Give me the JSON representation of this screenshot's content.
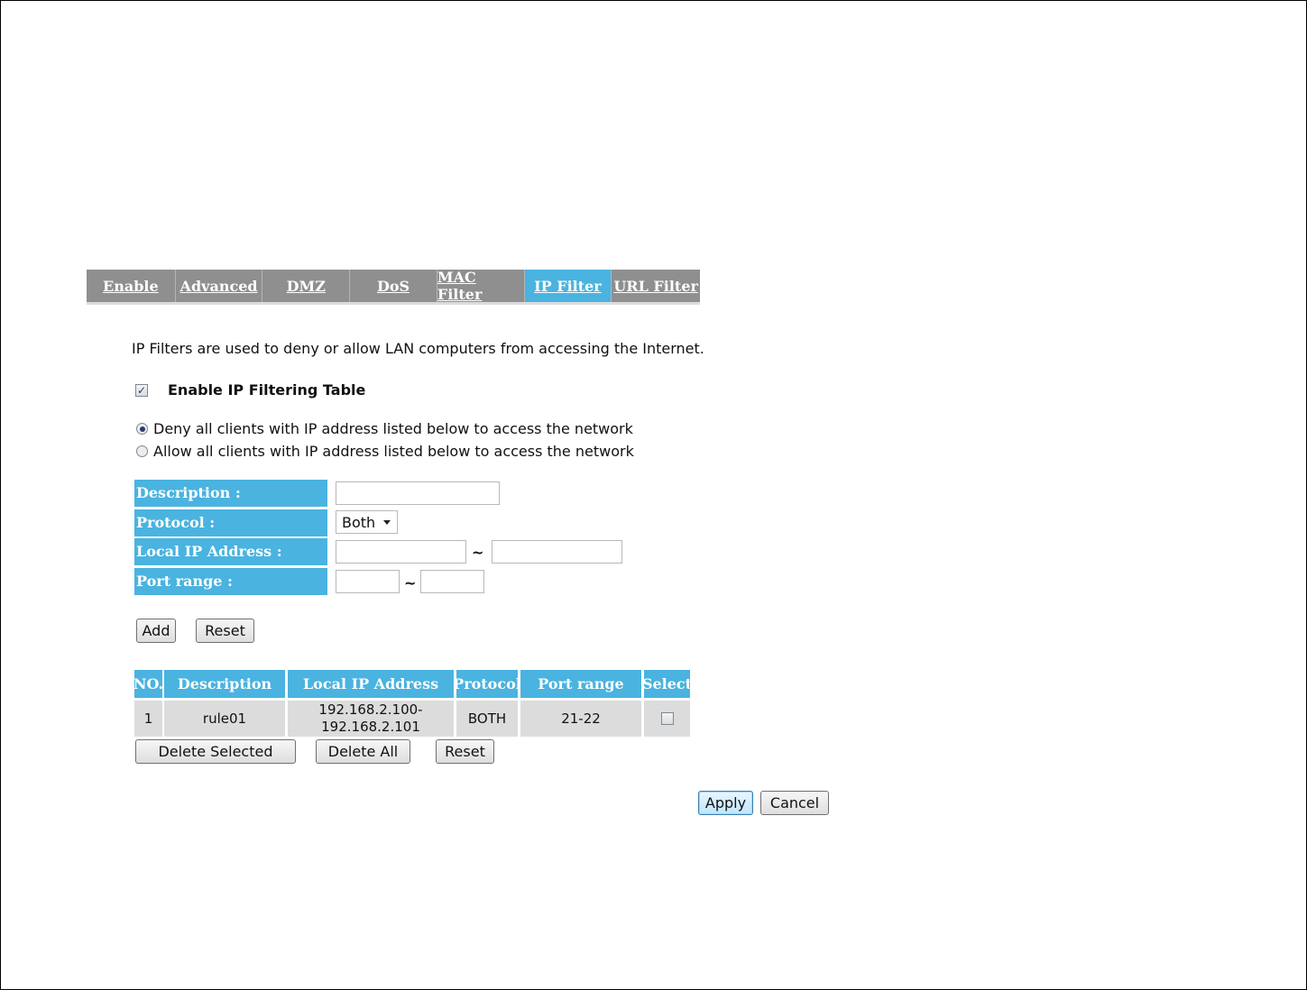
{
  "tabs": [
    "Enable",
    "Advanced",
    "DMZ",
    "DoS",
    "MAC Filter",
    "IP Filter",
    "URL Filter"
  ],
  "active_tab": "IP Filter",
  "intro_text": "IP Filters are used to deny or allow LAN computers from accessing the Internet.",
  "enable_label": "Enable IP Filtering Table",
  "enable_checked": true,
  "radio_deny": "Deny all clients with IP address listed below to access the network",
  "radio_allow": "Allow all clients with IP address listed below to access the network",
  "form": {
    "description_label": "Description :",
    "protocol_label": "Protocol :",
    "protocol_value": "Both",
    "local_ip_label": "Local IP Address :",
    "port_range_label": "Port range :",
    "tilde": "~"
  },
  "form_buttons": {
    "add": "Add",
    "reset": "Reset"
  },
  "table": {
    "headers": [
      "NO.",
      "Description",
      "Local IP Address",
      "Protocol",
      "Port range",
      "Select"
    ],
    "rows": [
      {
        "no": "1",
        "description": "rule01",
        "ip_start": "192.168.2.100-",
        "ip_end": "192.168.2.101",
        "protocol": "BOTH",
        "port_range": "21-22"
      }
    ]
  },
  "table_buttons": {
    "delete_selected": "Delete Selected",
    "delete_all": "Delete All",
    "reset": "Reset"
  },
  "footer_buttons": {
    "apply": "Apply",
    "cancel": "Cancel"
  },
  "colors": {
    "accent": "#4ab3e0",
    "tabbar": "#8f8f8f",
    "cell": "#dcdcdc"
  }
}
